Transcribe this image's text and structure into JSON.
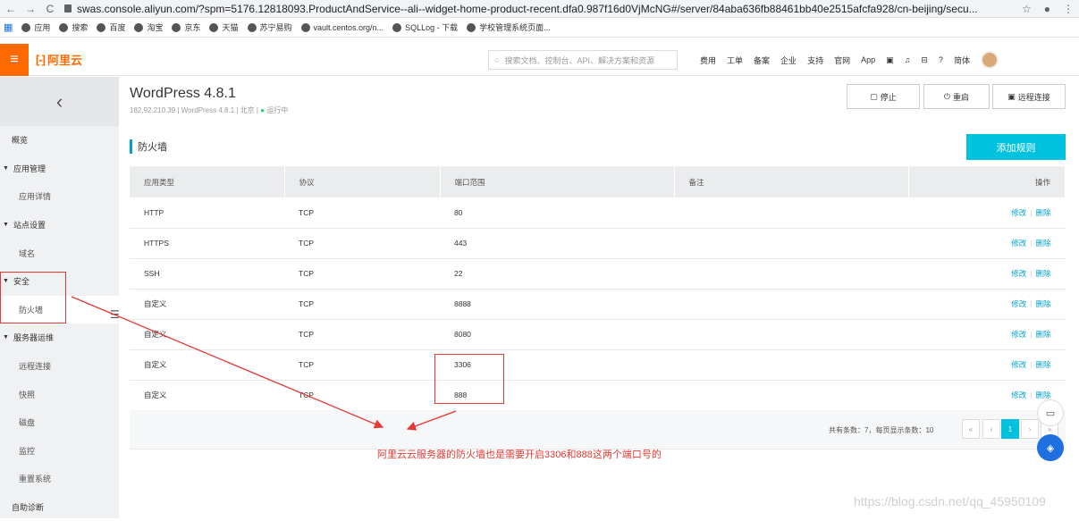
{
  "browser": {
    "url": "swas.console.aliyun.com/?spm=5176.12818093.ProductAndService--ali--widget-home-product-recent.dfa0.987f16d0VjMcNG#/server/84aba636fb88461bb40e2515afcfa928/cn-beijing/secu...",
    "bookmarks": [
      "应用",
      "搜索",
      "百度",
      "淘宝",
      "京东",
      "天猫",
      "苏宁易购",
      "vault.centos.org/n...",
      "SQLLog - 下载",
      "学校管理系统页面..."
    ]
  },
  "topnav": {
    "logo_text": "阿里云",
    "search_placeholder": "搜索文档、控制台、API、解决方案和资源",
    "links": [
      "费用",
      "工单",
      "备案",
      "企业",
      "支持",
      "官网",
      "App"
    ],
    "lang": "简体"
  },
  "sidebar": {
    "items": [
      {
        "label": "概览",
        "kind": "item"
      },
      {
        "label": "应用管理",
        "kind": "group"
      },
      {
        "label": "应用详情",
        "kind": "sub"
      },
      {
        "label": "站点设置",
        "kind": "group"
      },
      {
        "label": "域名",
        "kind": "sub"
      },
      {
        "label": "安全",
        "kind": "group"
      },
      {
        "label": "防火墙",
        "kind": "sub-active"
      },
      {
        "label": "服务器运维",
        "kind": "group"
      },
      {
        "label": "远程连接",
        "kind": "sub"
      },
      {
        "label": "快照",
        "kind": "sub"
      },
      {
        "label": "磁盘",
        "kind": "sub"
      },
      {
        "label": "监控",
        "kind": "sub"
      },
      {
        "label": "重置系统",
        "kind": "sub"
      },
      {
        "label": "自助诊断",
        "kind": "item"
      }
    ]
  },
  "header": {
    "title": "WordPress 4.8.1",
    "ip": "182.92.210.39",
    "app": "WordPress 4.8.1",
    "region": "北京",
    "status": "运行中",
    "stop_label": "停止",
    "restart_label": "重启",
    "remote_label": "远程连接"
  },
  "firewall": {
    "section_title": "防火墙",
    "add_label": "添加规则",
    "columns": [
      "应用类型",
      "协议",
      "端口范围",
      "备注",
      "操作"
    ],
    "rows": [
      [
        "HTTP",
        "TCP",
        "80",
        ""
      ],
      [
        "HTTPS",
        "TCP",
        "443",
        ""
      ],
      [
        "SSH",
        "TCP",
        "22",
        ""
      ],
      [
        "自定义",
        "TCP",
        "8888",
        ""
      ],
      [
        "自定义",
        "TCP",
        "8080",
        ""
      ],
      [
        "自定义",
        "TCP",
        "3306",
        ""
      ],
      [
        "自定义",
        "TCP",
        "888",
        ""
      ]
    ],
    "edit_label": "修改",
    "delete_label": "删除",
    "pager_text": "共有条数：7，每页显示条数：10",
    "current_page": "1"
  },
  "annotation": {
    "text": "阿里云云服务器的防火墙也是需要开启3306和888这两个端口号的",
    "color": "#e53935"
  },
  "watermark": "https://blog.csdn.net/qq_45950109"
}
